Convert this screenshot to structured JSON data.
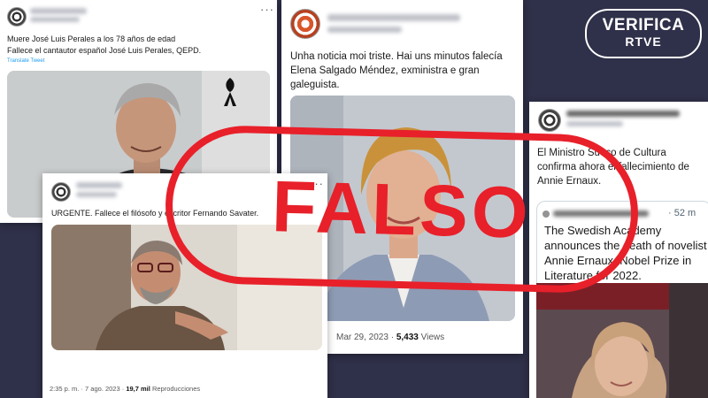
{
  "tweet_perales": {
    "text_line1": "Muere José Luis Perales a los 78 años de edad",
    "text_line2": "Fallece el cantautor español José Luis Perales, QEPD.",
    "translate": "Translate Tweet"
  },
  "tweet_salgado": {
    "text": "Unha noticia moi triste. Hai uns minutos falecía Elena Salgado Méndez, exministra e gran galeguista.",
    "date": "Mar 29, 2023",
    "views_count": "5,433",
    "views_label": "Views"
  },
  "tweet_savater": {
    "text": "URGENTE. Fallece el filósofo y escritor Fernando Savater.",
    "time": "2:35 p. m. · 7 ago. 2023 ·",
    "views_count": "19,7 mil",
    "views_label": "Reproducciones"
  },
  "tweet_ernaux": {
    "text": "El Ministro Sueco de Cultura confirma ahora el fallecimiento de Annie Ernaux.",
    "quote_time": "· 52 m",
    "quote_text": "The Swedish Academy announces the death of novelist Annie Ernaux, Nobel Prize in Literature for 2022."
  },
  "stamp": {
    "label": "FALSO",
    "color": "#e8202a"
  },
  "logo": {
    "line1": "VERIFICA",
    "line2": "RTVE"
  },
  "colors": {
    "background": "#2f3049",
    "stamp_red": "#e8202a"
  }
}
